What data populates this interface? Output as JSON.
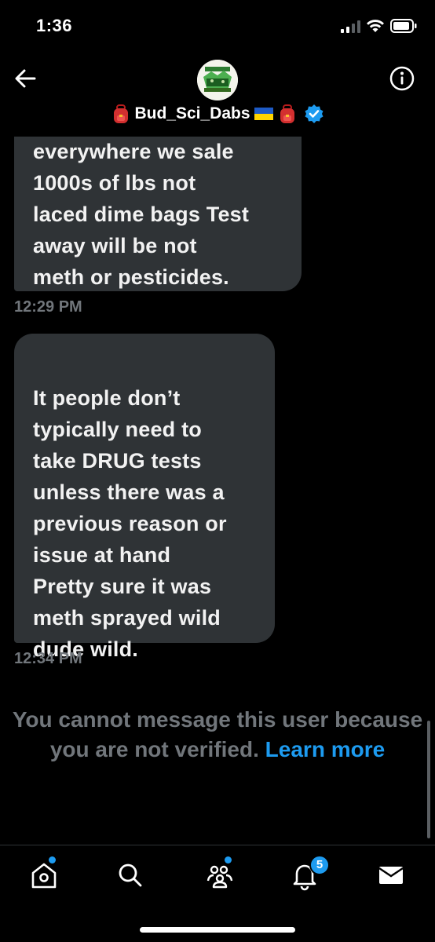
{
  "status_bar": {
    "time": "1:36"
  },
  "header": {
    "name": "Bud_Sci_Dabs",
    "avatar_icon": "dispensary-logo",
    "verified_icon": "verified-badge-icon"
  },
  "messages": [
    {
      "text": "everywhere we sale\n1000s of lbs not\nlaced dime bags Test\naway will be not\nmeth or pesticides.",
      "time": "12:29 PM"
    },
    {
      "text": "It people don’t\ntypically need to\ntake DRUG tests\nunless there was a\nprevious reason or\nissue at hand\nPretty sure it was\nmeth sprayed wild\ndude wild.",
      "time": "12:34 PM"
    }
  ],
  "notice": {
    "text": "You cannot message this user because you are not verified.",
    "link": "Learn more"
  },
  "nav": {
    "notifications_badge": "5",
    "items": [
      "home-icon",
      "search-icon",
      "communities-icon",
      "notifications-icon",
      "messages-icon"
    ]
  },
  "colors": {
    "bubble": "#2f3336",
    "muted": "#71767b",
    "accent": "#1d9bf0"
  }
}
